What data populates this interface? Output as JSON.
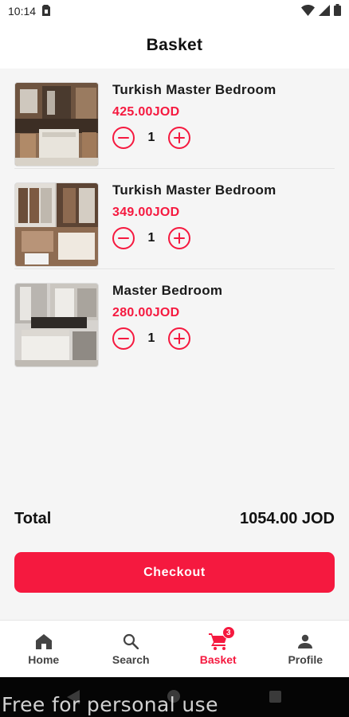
{
  "status_bar": {
    "time": "10:14"
  },
  "header": {
    "title": "Basket"
  },
  "basket": {
    "items": [
      {
        "name": "Turkish Master Bedroom",
        "price": "425.00JOD",
        "quantity": "1"
      },
      {
        "name": "Turkish Master Bedroom",
        "price": "349.00JOD",
        "quantity": "1"
      },
      {
        "name": "Master Bedroom",
        "price": "280.00JOD",
        "quantity": "1"
      }
    ]
  },
  "summary": {
    "total_label": "Total",
    "total_value": "1054.00 JOD",
    "checkout_label": "Checkout"
  },
  "bottom_nav": {
    "items": [
      {
        "label": "Home",
        "icon": "home-icon"
      },
      {
        "label": "Search",
        "icon": "search-icon"
      },
      {
        "label": "Basket",
        "icon": "cart-icon",
        "badge": "3",
        "active": true
      },
      {
        "label": "Profile",
        "icon": "person-icon"
      }
    ]
  },
  "watermark": "Free for personal use",
  "colors": {
    "accent": "#f5193f",
    "background": "#f5f5f5"
  }
}
